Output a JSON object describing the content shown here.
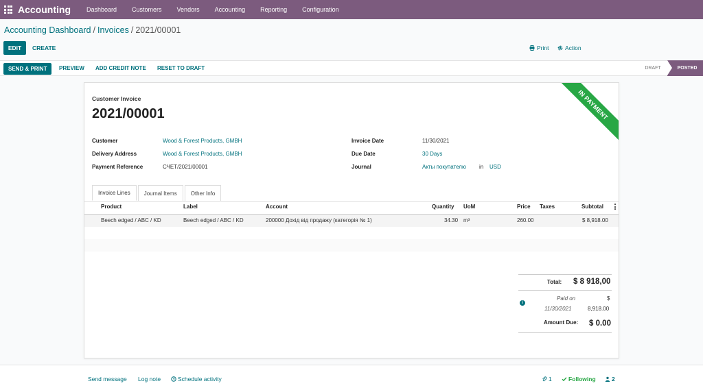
{
  "topbar": {
    "app_title": "Accounting",
    "menu": [
      "Dashboard",
      "Customers",
      "Vendors",
      "Accounting",
      "Reporting",
      "Configuration"
    ]
  },
  "breadcrumb": {
    "items": [
      "Accounting Dashboard",
      "Invoices"
    ],
    "current": "2021/00001",
    "separator": "/"
  },
  "control_panel": {
    "edit_label": "EDIT",
    "create_label": "CREATE",
    "print_label": "Print",
    "action_label": "Action"
  },
  "statusbar": {
    "send_print_label": "SEND & PRINT",
    "preview_label": "PREVIEW",
    "add_credit_note_label": "ADD CREDIT NOTE",
    "reset_to_draft_label": "RESET TO DRAFT",
    "stages": [
      {
        "label": "DRAFT",
        "active": false
      },
      {
        "label": "POSTED",
        "active": true
      }
    ]
  },
  "invoice": {
    "ribbon": "IN PAYMENT",
    "ribbon_color": "#28a745",
    "doc_type": "Customer Invoice",
    "name": "2021/00001",
    "customer_label": "Customer",
    "customer": "Wood & Forest Products, GMBH",
    "delivery_address_label": "Delivery Address",
    "delivery_address": "Wood & Forest Products, GMBH",
    "payment_reference_label": "Payment Reference",
    "payment_reference": "СЧЕТ/2021/00001",
    "invoice_date_label": "Invoice Date",
    "invoice_date": "11/30/2021",
    "due_date_label": "Due Date",
    "due_date": "30 Days",
    "journal_label": "Journal",
    "journal": "Акты покупателю",
    "journal_in": "in",
    "currency": "USD"
  },
  "tabs": [
    "Invoice Lines",
    "Journal Items",
    "Other Info"
  ],
  "lines": {
    "headers": {
      "product": "Product",
      "label": "Label",
      "account": "Account",
      "quantity": "Quantity",
      "uom": "UoM",
      "price": "Price",
      "taxes": "Taxes",
      "subtotal": "Subtotal"
    },
    "rows": [
      {
        "product": "Beech edged / ABC / KD",
        "label": "Beech edged / ABC / KD",
        "account": "200000 Дохід від продажу (категорія № 1)",
        "quantity": "34.30",
        "uom": "m³",
        "price": "260.00",
        "taxes": "",
        "subtotal": "$ 8,918.00"
      }
    ]
  },
  "totals": {
    "total_label": "Total:",
    "total_value": "$ 8 918,00",
    "paid_on_label": "Paid on",
    "paid_on_date": "11/30/2021",
    "paid_currency": "$",
    "paid_amount": "8,918.00",
    "amount_due_label": "Amount Due:",
    "amount_due_value": "$ 0.00"
  },
  "chatter": {
    "send_message": "Send message",
    "log_note": "Log note",
    "schedule_activity": "Schedule activity",
    "attachments_count": "1",
    "following": "Following",
    "followers_count": "2"
  },
  "colors": {
    "brand": "#7c5b7e",
    "primary": "#00717d",
    "success": "#28a745"
  }
}
